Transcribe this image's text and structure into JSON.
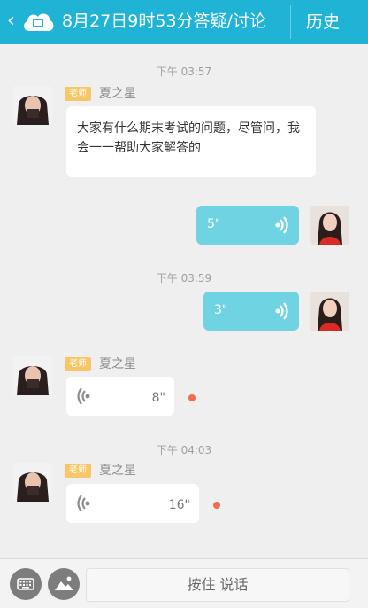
{
  "header": {
    "title": "8月27日9时53分答疑/讨论",
    "history_label": "历史",
    "back_glyph": "‹",
    "icons": [
      "back-icon",
      "cloud-icon"
    ]
  },
  "teacher": {
    "badge": "老师",
    "name": "夏之星"
  },
  "messages": {
    "time1": "下午 03:57",
    "text1": "大家有什么期末考试的问题，尽管问，我会一一帮助大家解答的",
    "voice1_duration": "5\"",
    "time2": "下午 03:59",
    "voice2_duration": "3\"",
    "voice3_duration": "8\"",
    "time3": "下午 04:03",
    "voice4_duration": "16\""
  },
  "input": {
    "talk_label": "按住 说话",
    "icons": [
      "keyboard-icon",
      "image-icon"
    ]
  },
  "colors": {
    "header": "#1fb3d6",
    "my_bubble": "#6fd3e2",
    "badge": "#f6c667",
    "unread_dot": "#f26b4d"
  }
}
